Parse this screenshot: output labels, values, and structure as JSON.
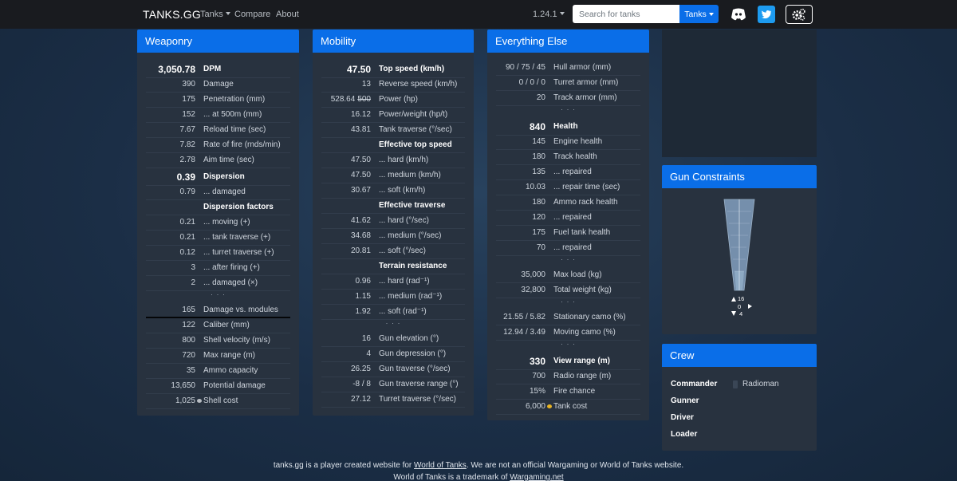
{
  "nav": {
    "brand": "TANKS.GG",
    "tanks": "Tanks",
    "compare": "Compare",
    "about": "About",
    "version": "1.24.1",
    "search_placeholder": "Search for tanks",
    "search_btn": "Tanks"
  },
  "weaponry": {
    "title": "Weaponry",
    "rows": [
      {
        "v": "3,050.78",
        "l": "DPM",
        "bold": true,
        "big": true
      },
      {
        "v": "390",
        "l": "Damage"
      },
      {
        "v": "175",
        "l": "Penetration (mm)"
      },
      {
        "v": "152",
        "l": "... at 500m (mm)"
      },
      {
        "v": "7.67",
        "l": "Reload time (sec)"
      },
      {
        "v": "7.82",
        "l": "Rate of fire (rnds/min)"
      },
      {
        "v": "2.78",
        "l": "Aim time (sec)"
      },
      {
        "v": "0.39",
        "l": "Dispersion",
        "bold": true,
        "big": true
      },
      {
        "v": "0.79",
        "l": "... damaged"
      },
      {
        "v": "",
        "l": "Dispersion factors",
        "head": true
      },
      {
        "v": "0.21",
        "l": "... moving (+)"
      },
      {
        "v": "0.21",
        "l": "... tank traverse (+)"
      },
      {
        "v": "0.12",
        "l": "... turret traverse (+)"
      },
      {
        "v": "3",
        "l": "... after firing (+)"
      },
      {
        "v": "2",
        "l": "... damaged (×)"
      },
      {
        "dots": "· · ·"
      },
      {
        "v": "165",
        "l": "Damage vs. modules",
        "underline": true
      },
      {
        "v": "122",
        "l": "Caliber (mm)"
      },
      {
        "v": "800",
        "l": "Shell velocity (m/s)"
      },
      {
        "v": "720",
        "l": "Max range (m)"
      },
      {
        "v": "35",
        "l": "Ammo capacity"
      },
      {
        "v": "13,650",
        "l": "Potential damage"
      },
      {
        "v": "1,025",
        "l": "Shell cost",
        "coin": "silver"
      }
    ]
  },
  "mobility": {
    "title": "Mobility",
    "rows": [
      {
        "v": "47.50",
        "l": "Top speed (km/h)",
        "bold": true,
        "big": true
      },
      {
        "v": "13",
        "l": "Reverse speed (km/h)"
      },
      {
        "v": "528.64",
        "strike": "500",
        "l": "Power (hp)"
      },
      {
        "v": "16.12",
        "l": "Power/weight (hp/t)"
      },
      {
        "v": "43.81",
        "l": "Tank traverse (°/sec)"
      },
      {
        "v": "",
        "l": "Effective top speed",
        "head": true
      },
      {
        "v": "47.50",
        "l": "... hard (km/h)"
      },
      {
        "v": "47.50",
        "l": "... medium (km/h)"
      },
      {
        "v": "30.67",
        "l": "... soft (km/h)"
      },
      {
        "v": "",
        "l": "Effective traverse",
        "head": true
      },
      {
        "v": "41.62",
        "l": "... hard (°/sec)"
      },
      {
        "v": "34.68",
        "l": "... medium (°/sec)"
      },
      {
        "v": "20.81",
        "l": "... soft (°/sec)"
      },
      {
        "v": "",
        "l": "Terrain resistance",
        "head": true
      },
      {
        "v": "0.96",
        "l": "... hard (rad⁻¹)"
      },
      {
        "v": "1.15",
        "l": "... medium (rad⁻¹)"
      },
      {
        "v": "1.92",
        "l": "... soft (rad⁻¹)"
      },
      {
        "dots": "· · ·"
      },
      {
        "v": "16",
        "l": "Gun elevation (°)"
      },
      {
        "v": "4",
        "l": "Gun depression (°)"
      },
      {
        "v": "26.25",
        "l": "Gun traverse (°/sec)"
      },
      {
        "v": "-8 / 8",
        "l": "Gun traverse range (°)"
      },
      {
        "v": "27.12",
        "l": "Turret traverse (°/sec)"
      }
    ]
  },
  "else": {
    "title": "Everything Else",
    "rows": [
      {
        "v": "90 / 75 / 45",
        "l": "Hull armor (mm)"
      },
      {
        "v": "0 / 0 / 0",
        "l": "Turret armor (mm)"
      },
      {
        "v": "20",
        "l": "Track armor (mm)"
      },
      {
        "dots": "· · ·"
      },
      {
        "v": "840",
        "l": "Health",
        "bold": true,
        "big": true
      },
      {
        "v": "145",
        "l": "Engine health"
      },
      {
        "v": "180",
        "l": "Track health"
      },
      {
        "v": "135",
        "l": "... repaired"
      },
      {
        "v": "10.03",
        "l": "... repair time (sec)"
      },
      {
        "v": "180",
        "l": "Ammo rack health"
      },
      {
        "v": "120",
        "l": "... repaired"
      },
      {
        "v": "175",
        "l": "Fuel tank health"
      },
      {
        "v": "70",
        "l": "... repaired"
      },
      {
        "dots": "· · ·"
      },
      {
        "v": "35,000",
        "l": "Max load (kg)"
      },
      {
        "v": "32,800",
        "l": "Total weight (kg)"
      },
      {
        "dots": "· · ·"
      },
      {
        "v": "21.55 / 5.82",
        "l": "Stationary camo (%)"
      },
      {
        "v": "12.94 / 3.49",
        "l": "Moving camo (%)"
      },
      {
        "dots": "· · ·"
      },
      {
        "v": "330",
        "l": "View range (m)",
        "bold": true,
        "big": true
      },
      {
        "v": "700",
        "l": "Radio range (m)"
      },
      {
        "v": "15%",
        "l": "Fire chance"
      },
      {
        "v": "6,000",
        "l": "Tank cost",
        "coin": "gold"
      }
    ]
  },
  "gun": {
    "title": "Gun Constraints",
    "elevation": "16",
    "center": "0",
    "depression": "4"
  },
  "crew": {
    "title": "Crew",
    "members": [
      {
        "role": "Commander",
        "sub": "Radioman"
      },
      {
        "role": "Gunner"
      },
      {
        "role": "Driver"
      },
      {
        "role": "Loader"
      }
    ]
  },
  "footer": {
    "line1_pre": "tanks.gg is a player created website for ",
    "line1_link": "World of Tanks",
    "line1_post": ". We are not an official Wargaming or World of Tanks website.",
    "line2_pre": "World of Tanks is a trademark of ",
    "line2_link": "Wargaming.net"
  },
  "colors": {
    "accent": "#0a6ee8",
    "card": "#28323f",
    "navbar": "#191b1f"
  }
}
